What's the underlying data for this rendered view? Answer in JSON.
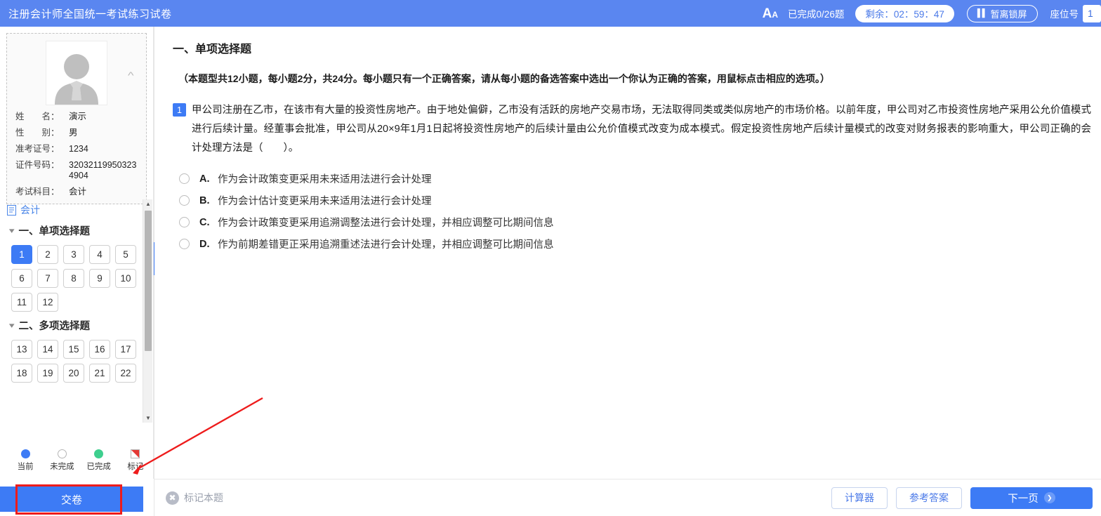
{
  "header": {
    "title": "注册会计师全国统一考试练习试卷",
    "font_size_icon": "font-size-icon",
    "progress": "已完成0/26题",
    "timer": "剩余：02：59：47",
    "lock_label": "暂离锁屏",
    "seat_label": "座位号",
    "seat_value": "1",
    "bg_color": "#5a86f0"
  },
  "profile": {
    "avatar_icon": "user-avatar-icon",
    "collapse_icon": "chevron-up-icon",
    "rows": [
      {
        "label": "姓　　名：",
        "value": "演示"
      },
      {
        "label": "性　　别：",
        "value": "男"
      },
      {
        "label": "准考证号：",
        "value": "1234"
      },
      {
        "label": "证件号码：",
        "value": "320321199503234904"
      },
      {
        "label": "考试科目：",
        "value": "会计"
      }
    ]
  },
  "nav": {
    "subject": "会计",
    "subject_icon": "document-icon",
    "sections": [
      {
        "title": "一、单项选择题",
        "questions": [
          "1",
          "2",
          "3",
          "4",
          "5",
          "6",
          "7",
          "8",
          "9",
          "10",
          "11",
          "12"
        ],
        "current": "1"
      },
      {
        "title": "二、多项选择题",
        "questions": [
          "13",
          "14",
          "15",
          "16",
          "17",
          "18",
          "19",
          "20",
          "21",
          "22"
        ],
        "current": ""
      }
    ],
    "collapse_handle_icon": "chevron-left-icon"
  },
  "legend": [
    {
      "label": "当前",
      "type": "current",
      "color": "#3d7bf5"
    },
    {
      "label": "未完成",
      "type": "undone",
      "color": "#ffffff"
    },
    {
      "label": "已完成",
      "type": "done",
      "color": "#3ecf8e"
    },
    {
      "label": "标记",
      "type": "flagged",
      "color": "#e53935"
    }
  ],
  "submit": {
    "label": "交卷",
    "highlight_color": "#ee1c1c"
  },
  "main": {
    "section_title": "一、单项选择题",
    "section_note": "（本题型共12小题，每小题2分，共24分。每小题只有一个正确答案，请从每小题的备选答案中选出一个你认为正确的答案，用鼠标点击相应的选项。）",
    "question": {
      "number": "1",
      "text": "甲公司注册在乙市，在该市有大量的投资性房地产。由于地处偏僻，乙市没有活跃的房地产交易市场，无法取得同类或类似房地产的市场价格。以前年度，甲公司对乙市投资性房地产采用公允价值模式进行后续计量。经董事会批准，甲公司从20×9年1月1日起将投资性房地产的后续计量由公允价值模式改变为成本模式。假定投资性房地产后续计量模式的改变对财务报表的影响重大，甲公司正确的会计处理方法是（　　）。",
      "options": [
        {
          "letter": "A.",
          "text": "作为会计政策变更采用未来适用法进行会计处理",
          "selected": false
        },
        {
          "letter": "B.",
          "text": "作为会计估计变更采用未来适用法进行会计处理",
          "selected": false
        },
        {
          "letter": "C.",
          "text": "作为会计政策变更采用追溯调整法进行会计处理，并相应调整可比期间信息",
          "selected": false
        },
        {
          "letter": "D.",
          "text": "作为前期差错更正采用追溯重述法进行会计处理，并相应调整可比期间信息",
          "selected": false
        }
      ]
    }
  },
  "footer": {
    "mark_icon": "mark-star-icon",
    "mark_label": "标记本题",
    "calculator_label": "计算器",
    "answer_label": "参考答案",
    "next_label": "下一页",
    "next_icon": "chevron-right-icon"
  }
}
